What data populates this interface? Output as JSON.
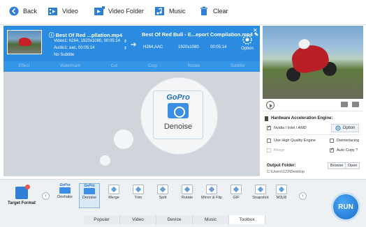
{
  "toolbar": {
    "back": "Back",
    "video": "Video",
    "video_folder": "Video Folder",
    "music": "Music",
    "clear": "Clear"
  },
  "file": {
    "source_title": "Best Of Red ...pllation.mp4",
    "video_info": "Video1: h264, 1920x1080, 00:05:14",
    "audio_info": "Audio1: aac, 00:05:14",
    "subtitle": "No Subtitle",
    "output_title": "Best Of Red Bull - E...eport Compilation.mp4",
    "output_codec": "H264,AAC",
    "output_res": "1920x1080",
    "output_dur": "00:05:14",
    "option": "Option"
  },
  "edit_tools": [
    "Effect",
    "Watermark",
    "Cut",
    "Crop",
    "Rotate",
    "Subtitle"
  ],
  "callout": {
    "brand": "GoPro",
    "label": "Denoise"
  },
  "settings": {
    "hw_title": "Hardware Acceleration Engine:",
    "hw_option": "Nvidia / Intel / AMD",
    "option_btn": "Option",
    "high_quality": "Use High Quality Engine",
    "deinterlacing": "Deinterlacing",
    "merge": "Merge",
    "auto_copy": "Auto Copy",
    "output_folder_label": "Output Folder:",
    "output_path": "C:\\Users\\123\\Desktop",
    "browse": "Browse",
    "open": "Open"
  },
  "bottom": {
    "target_format": "Target Format",
    "tools": [
      {
        "label": "Deshake",
        "gopro": true
      },
      {
        "label": "Denoise",
        "gopro": true,
        "selected": true
      },
      {
        "label": "Merge"
      },
      {
        "label": "Trim"
      },
      {
        "label": "Split"
      },
      {
        "label": "Rotate"
      },
      {
        "label": "Mirror & Flip"
      },
      {
        "label": "GIF"
      },
      {
        "label": "Snapshot"
      },
      {
        "label": "M3U8"
      }
    ],
    "gopro_text": "GoPro",
    "tabs": [
      "Popular",
      "Video",
      "Device",
      "Music",
      "Toolbox"
    ],
    "active_tab": "Toolbox",
    "run": "RUN"
  },
  "colors": {
    "accent": "#2b8be0",
    "run": "#1a6ec9"
  }
}
